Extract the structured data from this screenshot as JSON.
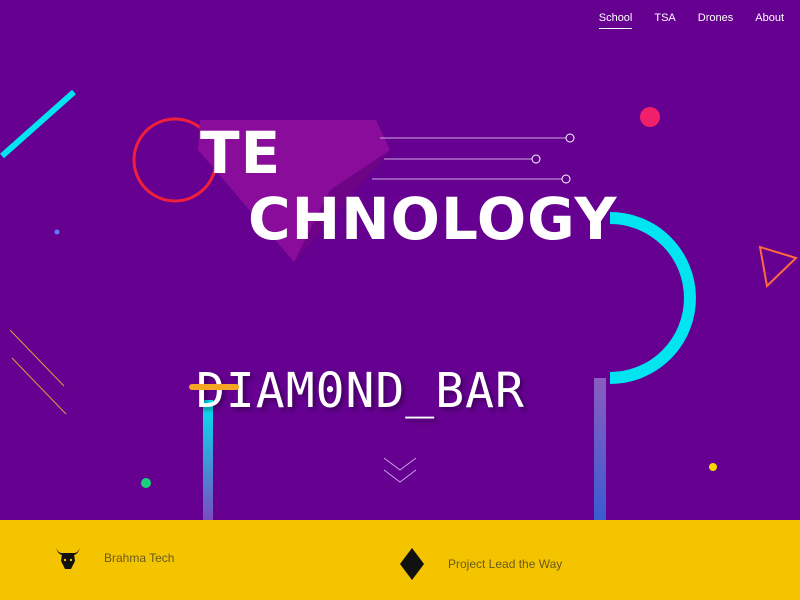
{
  "nav": {
    "items": [
      {
        "label": "School",
        "active": true
      },
      {
        "label": "TSA",
        "active": false
      },
      {
        "label": "Drones",
        "active": false
      },
      {
        "label": "About",
        "active": false
      }
    ]
  },
  "hero": {
    "title_line1": "TE",
    "title_line2": "CHNOLOGY",
    "subtitle": "DIAM0ND_BAR",
    "colors": {
      "background": "#650090",
      "accent_cyan": "#00e5f0",
      "accent_red": "#f0203c",
      "accent_orange": "#f5a623",
      "accent_yellow": "#f5c400"
    },
    "scroll_icon": "chevron-down-icon"
  },
  "footer": {
    "items": [
      {
        "label": "Brahma Tech",
        "icon": "bull-head-icon"
      },
      {
        "label": "Project Lead the Way",
        "icon": "diamond-icon"
      }
    ]
  }
}
